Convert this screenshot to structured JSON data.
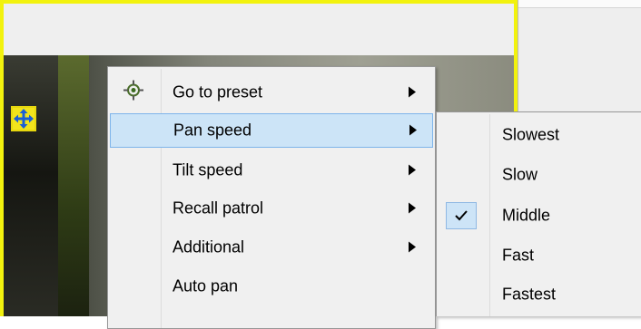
{
  "menu": {
    "items": [
      {
        "label": "Go to preset",
        "icon": "target-icon",
        "has_submenu": true,
        "highlighted": false
      },
      {
        "label": "Pan speed",
        "has_submenu": true,
        "highlighted": true
      },
      {
        "label": "Tilt speed",
        "has_submenu": true,
        "highlighted": false
      },
      {
        "label": "Recall patrol",
        "has_submenu": true,
        "highlighted": false
      },
      {
        "label": "Additional",
        "has_submenu": true,
        "highlighted": false
      },
      {
        "label": "Auto pan",
        "has_submenu": false,
        "highlighted": false
      }
    ],
    "arrow_glyph": "▶"
  },
  "pan_speed_submenu": {
    "items": [
      {
        "label": "Slowest",
        "checked": false
      },
      {
        "label": "Slow",
        "checked": false
      },
      {
        "label": "Middle",
        "checked": true
      },
      {
        "label": "Fast",
        "checked": false
      },
      {
        "label": "Fastest",
        "checked": false
      }
    ]
  },
  "ptz_control": {
    "icon": "move-arrows-icon"
  },
  "colors": {
    "selected_pane_border": "#f2f20e",
    "highlight_bg": "#cce4f7",
    "highlight_border": "#7eb4ea",
    "ptz_arrows": "#1a5fd6"
  }
}
